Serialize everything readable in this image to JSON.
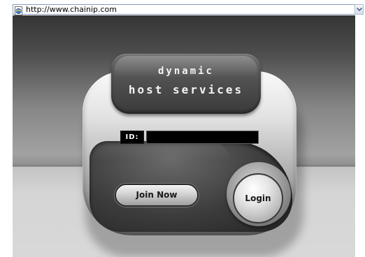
{
  "browser": {
    "url": "http://www.chainip.com",
    "page_icon": "ie-page-icon",
    "dropdown_icon": "chevron-down-icon"
  },
  "login_panel": {
    "title_line1": "dynamic",
    "title_line2": "host services",
    "id_label": "ID:",
    "id_value": "",
    "join_label": "Join Now",
    "login_label": "Login"
  },
  "colors": {
    "panel_dark": "#3a3a3a",
    "panel_light": "#e2e2e2",
    "field_black": "#000000"
  }
}
